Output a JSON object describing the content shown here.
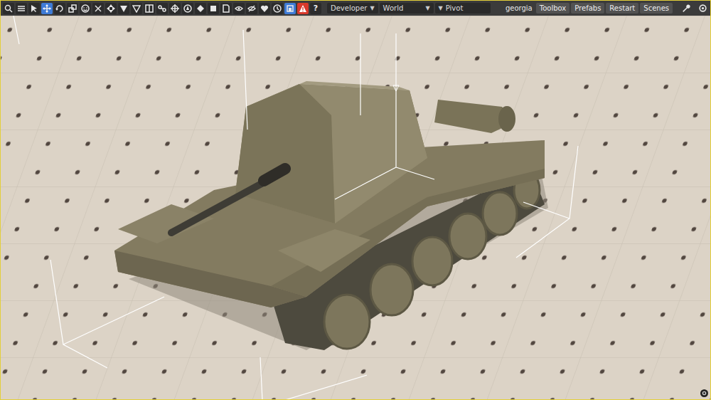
{
  "toolbar": {
    "tools": [
      {
        "kind": "search",
        "selected": false
      },
      {
        "kind": "menu",
        "selected": false
      },
      {
        "kind": "select",
        "selected": false
      },
      {
        "kind": "move",
        "selected": true
      },
      {
        "kind": "rotate",
        "selected": false
      },
      {
        "kind": "scale",
        "selected": false
      },
      {
        "kind": "smiley",
        "selected": false
      },
      {
        "kind": "cross",
        "selected": false
      },
      {
        "kind": "arrows",
        "selected": false
      },
      {
        "kind": "triangle",
        "selected": false
      },
      {
        "kind": "outline",
        "selected": false
      },
      {
        "kind": "panel",
        "selected": false
      },
      {
        "kind": "links",
        "selected": false
      },
      {
        "kind": "target",
        "selected": false
      },
      {
        "kind": "compass",
        "selected": false
      },
      {
        "kind": "diamond",
        "selected": false
      },
      {
        "kind": "box",
        "selected": false
      },
      {
        "kind": "document",
        "selected": false
      },
      {
        "kind": "eye",
        "selected": false
      },
      {
        "kind": "eyeoff",
        "selected": false
      },
      {
        "kind": "heart",
        "selected": false
      },
      {
        "kind": "clock",
        "selected": false
      },
      {
        "kind": "snap",
        "selected": true
      },
      {
        "kind": "warning",
        "selected": false
      }
    ],
    "help": "?",
    "dropdowns": [
      {
        "label": "Developer",
        "arrow": "▼"
      },
      {
        "label": "World",
        "arrow": "▼"
      },
      {
        "label": "Pivot",
        "arrow": "▼"
      }
    ],
    "user": "georgia",
    "buttons": [
      "Toolbox",
      "Prefabs",
      "Restart",
      "Scenes"
    ]
  }
}
